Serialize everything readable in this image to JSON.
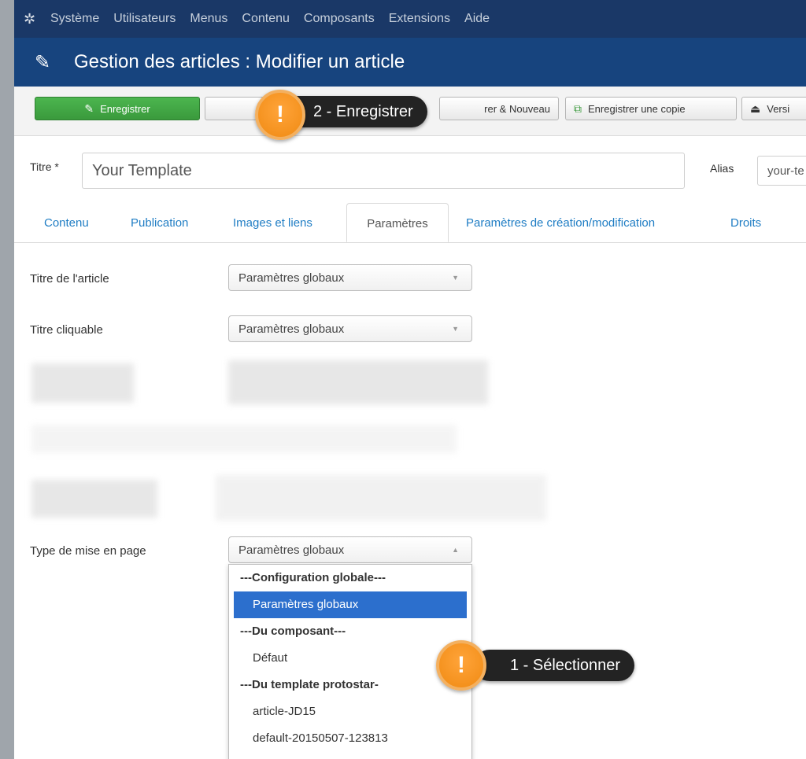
{
  "menu": {
    "logo": "joomla-logo",
    "items": [
      "Système",
      "Utilisateurs",
      "Menus",
      "Contenu",
      "Composants",
      "Extensions",
      "Aide"
    ]
  },
  "header": {
    "title": "Gestion des articles : Modifier un article",
    "icon": "pencil-icon"
  },
  "toolbar": {
    "save": "Enregistrer",
    "save_new": "rer & Nouveau",
    "save_copy": "Enregistrer une copie",
    "versions": "Versi"
  },
  "form": {
    "title_label": "Titre *",
    "title_value": "Your Template",
    "alias_label": "Alias",
    "alias_value": "your-te"
  },
  "tabs": [
    "Contenu",
    "Publication",
    "Images et liens",
    "Paramètres",
    "Paramètres de création/modification",
    "Droits"
  ],
  "active_tab": "Paramètres",
  "fields": {
    "article_title_label": "Titre de l'article",
    "article_title_value": "Paramètres globaux",
    "clickable_title_label": "Titre cliquable",
    "clickable_title_value": "Paramètres globaux",
    "layout_label": "Type de mise en page",
    "layout_value": "Paramètres globaux"
  },
  "dropdown": {
    "options": [
      {
        "label": "---Configuration globale---",
        "type": "group"
      },
      {
        "label": "Paramètres globaux",
        "type": "item",
        "selected": true
      },
      {
        "label": "---Du composant---",
        "type": "group"
      },
      {
        "label": "Défaut",
        "type": "item"
      },
      {
        "label": "---Du template protostar-",
        "type": "group"
      },
      {
        "label": "article-JD15",
        "type": "item"
      },
      {
        "label": "default-20150507-123813",
        "type": "item"
      }
    ]
  },
  "callouts": {
    "save": {
      "badge": "!",
      "text": "2 - Enregistrer"
    },
    "select": {
      "badge": "!",
      "text": "1 - Sélectionner"
    }
  },
  "colors": {
    "menubar": "#1a3867",
    "header": "#17447e",
    "primary_button": "#3a9a3c",
    "link": "#1f7dc4",
    "selected_option": "#2c6fcd",
    "callout_orange": "#f08a12"
  }
}
